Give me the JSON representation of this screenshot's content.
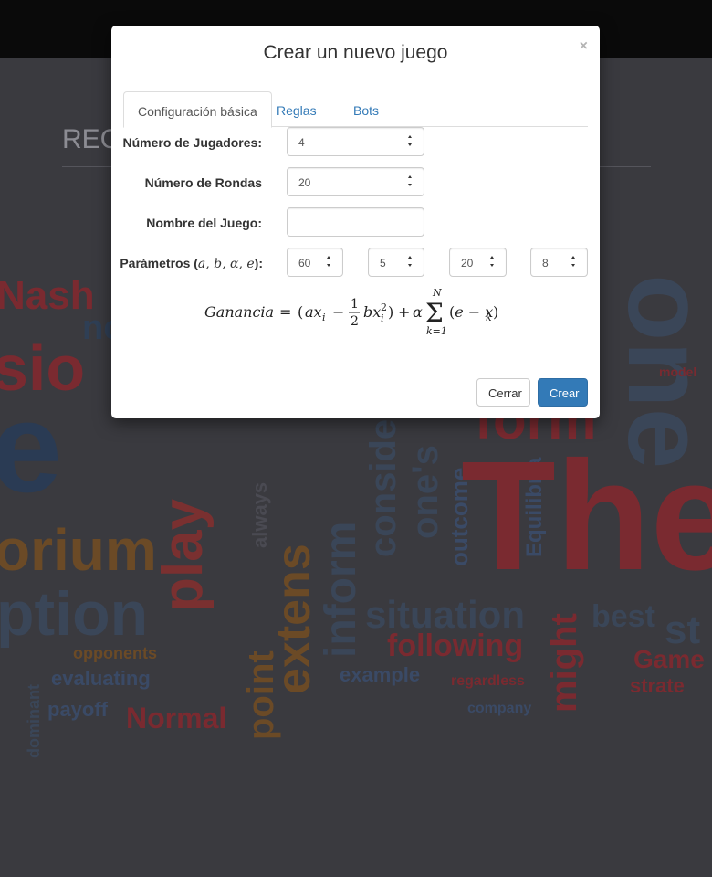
{
  "background": {
    "heading": "REC",
    "words": [
      "Nash",
      "sio",
      "no",
      "e",
      "orium",
      "ption",
      "evaluating",
      "payoff",
      "Normal",
      "opponents",
      "play",
      "always",
      "point",
      "extens",
      "inform",
      "conside",
      "one's",
      "situation",
      "following",
      "example",
      "outcome",
      "Equilibria",
      "might",
      "best",
      "The",
      "one",
      "Game",
      "strate",
      "company",
      "regardless",
      "form",
      "model",
      "dominant",
      "st"
    ]
  },
  "modal": {
    "title": "Crear un nuevo juego",
    "close_symbol": "×",
    "tabs": [
      {
        "label": "Configuración básica",
        "active": true
      },
      {
        "label": "Reglas",
        "active": false
      },
      {
        "label": "Bots",
        "active": false
      }
    ],
    "form": {
      "players": {
        "label": "Número de Jugadores:",
        "value": "4"
      },
      "rounds": {
        "label": "Número de Rondas",
        "value": "20"
      },
      "name": {
        "label": "Nombre del Juego:",
        "value": ""
      },
      "params": {
        "label_prefix": "Parámetros (",
        "label_symbols": "a, b, α, e",
        "label_suffix": "):",
        "values": [
          "60",
          "5",
          "20",
          "8"
        ]
      }
    },
    "formula": {
      "lhs": "Ganancia",
      "text": "Ganancia = (ax_i − ½ bx_i²) + α Σ_{k=1}^{N} (e − x_k)"
    },
    "footer": {
      "close_label": "Cerrar",
      "create_label": "Crear"
    }
  },
  "colors": {
    "primary": "#337ab7",
    "link": "#337ab7",
    "cloud_red": "#8b2a33",
    "cloud_blue": "#2f4a6a",
    "cloud_orange": "#8a5a2a"
  }
}
